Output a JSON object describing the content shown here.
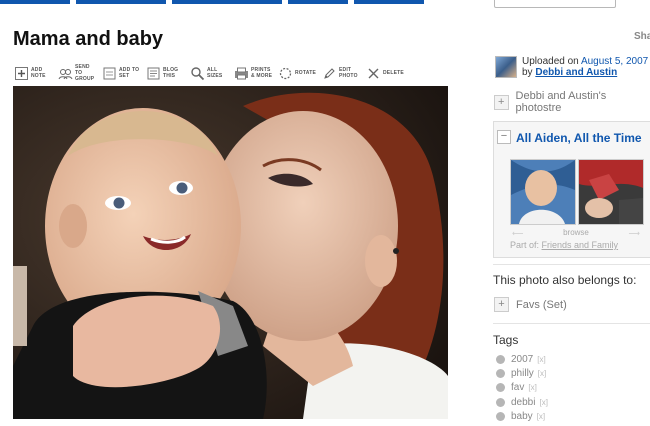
{
  "page": {
    "title": "Mama and baby",
    "share_label": "Sha"
  },
  "toolbar": {
    "items": [
      {
        "label": "ADD NOTE",
        "icon": "add-note-icon"
      },
      {
        "label": "SEND TO GROUP",
        "icon": "send-to-group-icon"
      },
      {
        "label": "ADD TO SET",
        "icon": "add-to-set-icon"
      },
      {
        "label": "BLOG THIS",
        "icon": "blog-this-icon"
      },
      {
        "label": "ALL SIZES",
        "icon": "magnifier-icon"
      },
      {
        "label": "PRINTS & MORE",
        "icon": "prints-icon"
      },
      {
        "label": "ROTATE",
        "icon": "rotate-icon"
      },
      {
        "label": "EDIT PHOTO",
        "icon": "pencil-icon"
      },
      {
        "label": "DELETE",
        "icon": "delete-icon"
      }
    ]
  },
  "uploader": {
    "uploaded_prefix": "Uploaded on",
    "date": "August 5, 2007",
    "by_prefix": "by",
    "name": "Debbi and Austin"
  },
  "photostream": {
    "label": "Debbi and Austin's photostre"
  },
  "set": {
    "title": "All Aiden, All the Time",
    "browse_label": "browse",
    "part_of_prefix": "Part of:",
    "part_of_link": "Friends and Family"
  },
  "belongs": {
    "heading": "This photo also belongs to:",
    "favs": "Favs (Set)"
  },
  "tags": {
    "heading": "Tags",
    "remove_label": "[x]",
    "items": [
      "2007",
      "philly",
      "fav",
      "debbi",
      "baby"
    ]
  },
  "colors": {
    "link": "#1057ae",
    "muted": "#888888"
  }
}
